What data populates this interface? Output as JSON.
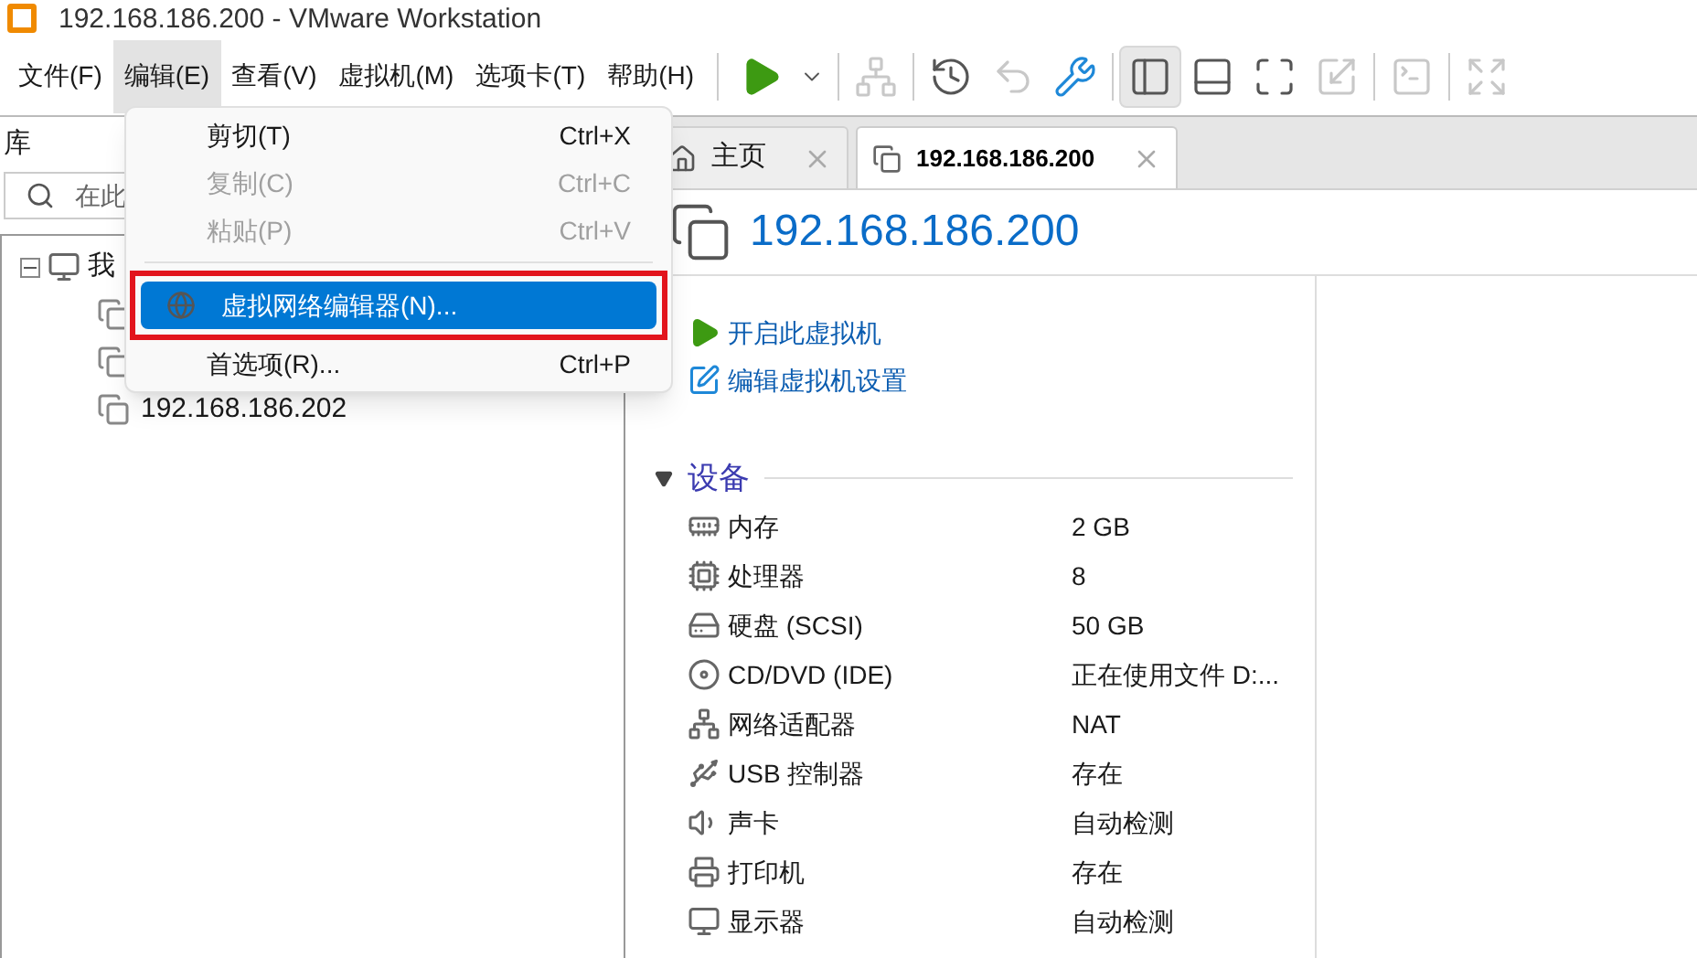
{
  "window": {
    "title": "192.168.186.200 - VMware Workstation"
  },
  "menu_bar": [
    {
      "label": "文件(F)",
      "selected": false
    },
    {
      "label": "编辑(E)",
      "selected": true
    },
    {
      "label": "查看(V)",
      "selected": false
    },
    {
      "label": "虚拟机(M)",
      "selected": false
    },
    {
      "label": "选项卡(T)",
      "selected": false
    },
    {
      "label": "帮助(H)",
      "selected": false
    }
  ],
  "toolbar": [
    {
      "kind": "play",
      "selected": false,
      "disabled": false
    },
    {
      "kind": "dropdown",
      "selected": false,
      "disabled": false
    },
    {
      "kind": "separator"
    },
    {
      "kind": "send-keys",
      "selected": false,
      "disabled": true
    },
    {
      "kind": "separator"
    },
    {
      "kind": "snapshot-take",
      "selected": false,
      "disabled": false
    },
    {
      "kind": "snapshot-revert",
      "selected": false,
      "disabled": true
    },
    {
      "kind": "snapshot-manage",
      "selected": false,
      "disabled": false
    },
    {
      "kind": "separator"
    },
    {
      "kind": "view-library",
      "selected": true,
      "disabled": false
    },
    {
      "kind": "view-thumbnail",
      "selected": false,
      "disabled": false
    },
    {
      "kind": "view-full",
      "selected": false,
      "disabled": false
    },
    {
      "kind": "view-unity",
      "selected": false,
      "disabled": true
    },
    {
      "kind": "separator"
    },
    {
      "kind": "console",
      "selected": false,
      "disabled": true
    },
    {
      "kind": "separator"
    },
    {
      "kind": "stretch",
      "selected": false,
      "disabled": true
    }
  ],
  "library": {
    "title": "库",
    "search": {
      "placeholder": "在此"
    },
    "tree": [
      {
        "label": "我",
        "expanded": true,
        "children": [
          {
            "kind": "vm"
          },
          {
            "kind": "vm"
          },
          {
            "kind": "vm",
            "label": "192.168.186.202"
          }
        ]
      }
    ]
  },
  "edit_menu": [
    {
      "kind": "item",
      "label": "剪切(T)",
      "shortcut": "Ctrl+X",
      "disabled": false,
      "selected": false,
      "outlined": false
    },
    {
      "kind": "item",
      "label": "复制(C)",
      "shortcut": "Ctrl+C",
      "disabled": true,
      "selected": false,
      "outlined": false
    },
    {
      "kind": "item",
      "label": "粘贴(P)",
      "shortcut": "Ctrl+V",
      "disabled": true,
      "selected": false,
      "outlined": false
    },
    {
      "kind": "separator"
    },
    {
      "kind": "item",
      "label": "虚拟网络编辑器(N)...",
      "disabled": false,
      "selected": true,
      "outlined": true
    },
    {
      "kind": "item",
      "label": "首选项(R)...",
      "shortcut": "Ctrl+P",
      "disabled": false,
      "selected": false,
      "outlined": false
    }
  ],
  "tabs": [
    {
      "kind": "home",
      "label": "主页",
      "selected": false
    },
    {
      "kind": "vm",
      "label": "192.168.186.200",
      "selected": true
    }
  ],
  "vm": {
    "title": "192.168.186.200",
    "actions": [
      {
        "kind": "power-on",
        "label": "开启此虚拟机"
      },
      {
        "kind": "edit",
        "label": "编辑虚拟机设置"
      }
    ],
    "devices_section": {
      "title": "设备",
      "expanded": true
    },
    "devices": [
      {
        "kind": "memory",
        "name": "内存",
        "value": "2 GB"
      },
      {
        "kind": "cpu",
        "name": "处理器",
        "value": "8"
      },
      {
        "kind": "disk",
        "name": "硬盘 (SCSI)",
        "value": "50 GB"
      },
      {
        "kind": "cd",
        "name": "CD/DVD (IDE)",
        "value": "正在使用文件 D:..."
      },
      {
        "kind": "network",
        "name": "网络适配器",
        "value": "NAT"
      },
      {
        "kind": "usb",
        "name": "USB 控制器",
        "value": "存在"
      },
      {
        "kind": "sound",
        "name": "声卡",
        "value": "自动检测"
      },
      {
        "kind": "printer",
        "name": "打印机",
        "value": "存在"
      },
      {
        "kind": "display",
        "name": "显示器",
        "value": "自动检测"
      }
    ]
  }
}
